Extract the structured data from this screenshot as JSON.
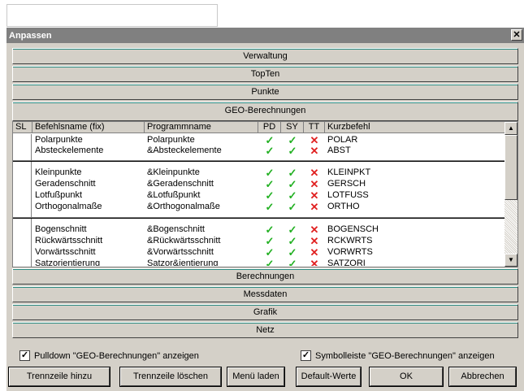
{
  "window": {
    "title": "Anpassen",
    "close_glyph": "✕"
  },
  "sections_top": [
    "Verwaltung",
    "TopTen",
    "Punkte",
    "GEO-Berechnungen"
  ],
  "sections_bottom": [
    "Berechnungen",
    "Messdaten",
    "Grafik",
    "Netz"
  ],
  "table": {
    "headers": [
      "SL",
      "Befehlsname (fix)",
      "Programmname",
      "PD",
      "SY",
      "TT",
      "Kurzbefehl"
    ],
    "rows": [
      {
        "name": "Polarpunkte",
        "prog": "Polarpunkte",
        "pd": "✓",
        "sy": "✓",
        "tt": "✕",
        "short": "POLAR"
      },
      {
        "name": "Absteckelemente",
        "prog": "&Absteckelemente",
        "pd": "✓",
        "sy": "✓",
        "tt": "✕",
        "short": "ABST"
      },
      {
        "name": "Kleinpunkte",
        "prog": "&Kleinpunkte",
        "pd": "✓",
        "sy": "✓",
        "tt": "✕",
        "short": "KLEINPKT"
      },
      {
        "name": "Geradenschnitt",
        "prog": "&Geradenschnitt",
        "pd": "✓",
        "sy": "✓",
        "tt": "✕",
        "short": "GERSCH"
      },
      {
        "name": "Lotfußpunkt",
        "prog": "&Lotfußpunkt",
        "pd": "✓",
        "sy": "✓",
        "tt": "✕",
        "short": "LOTFUSS"
      },
      {
        "name": "Orthogonalmaße",
        "prog": "&Orthogonalmaße",
        "pd": "✓",
        "sy": "✓",
        "tt": "✕",
        "short": "ORTHO"
      },
      {
        "name": "Bogenschnitt",
        "prog": "&Bogenschnitt",
        "pd": "✓",
        "sy": "✓",
        "tt": "✕",
        "short": "BOGENSCH"
      },
      {
        "name": "Rückwärtsschnitt",
        "prog": "&Rückwärtsschnitt",
        "pd": "✓",
        "sy": "✓",
        "tt": "✕",
        "short": "RCKWRTS"
      },
      {
        "name": "Vorwärtsschnitt",
        "prog": "&Vorwärtsschnitt",
        "pd": "✓",
        "sy": "✓",
        "tt": "✕",
        "short": "VORWRTS"
      },
      {
        "name": "Satzorientierung",
        "prog": "Satzor&ientierung",
        "pd": "✓",
        "sy": "✓",
        "tt": "✕",
        "short": "SATZORI"
      }
    ]
  },
  "scrollbar": {
    "up_glyph": "▲",
    "down_glyph": "▼"
  },
  "checkboxes": {
    "pulldown": {
      "label": "Pulldown \"GEO-Berechnungen\" anzeigen",
      "checked_glyph": "✓"
    },
    "toolbar": {
      "label": "Symbolleiste \"GEO-Berechnungen\" anzeigen",
      "checked_glyph": "✓"
    }
  },
  "buttons": [
    "Trennzeile hinzu",
    "Trennzeile löschen",
    "Menü laden",
    "Default-Werte",
    "OK",
    "Abbrechen"
  ],
  "colors": {
    "check": "#22b022",
    "cross": "#e02020",
    "title_bar": "#808080",
    "face": "#d4d0c8"
  }
}
